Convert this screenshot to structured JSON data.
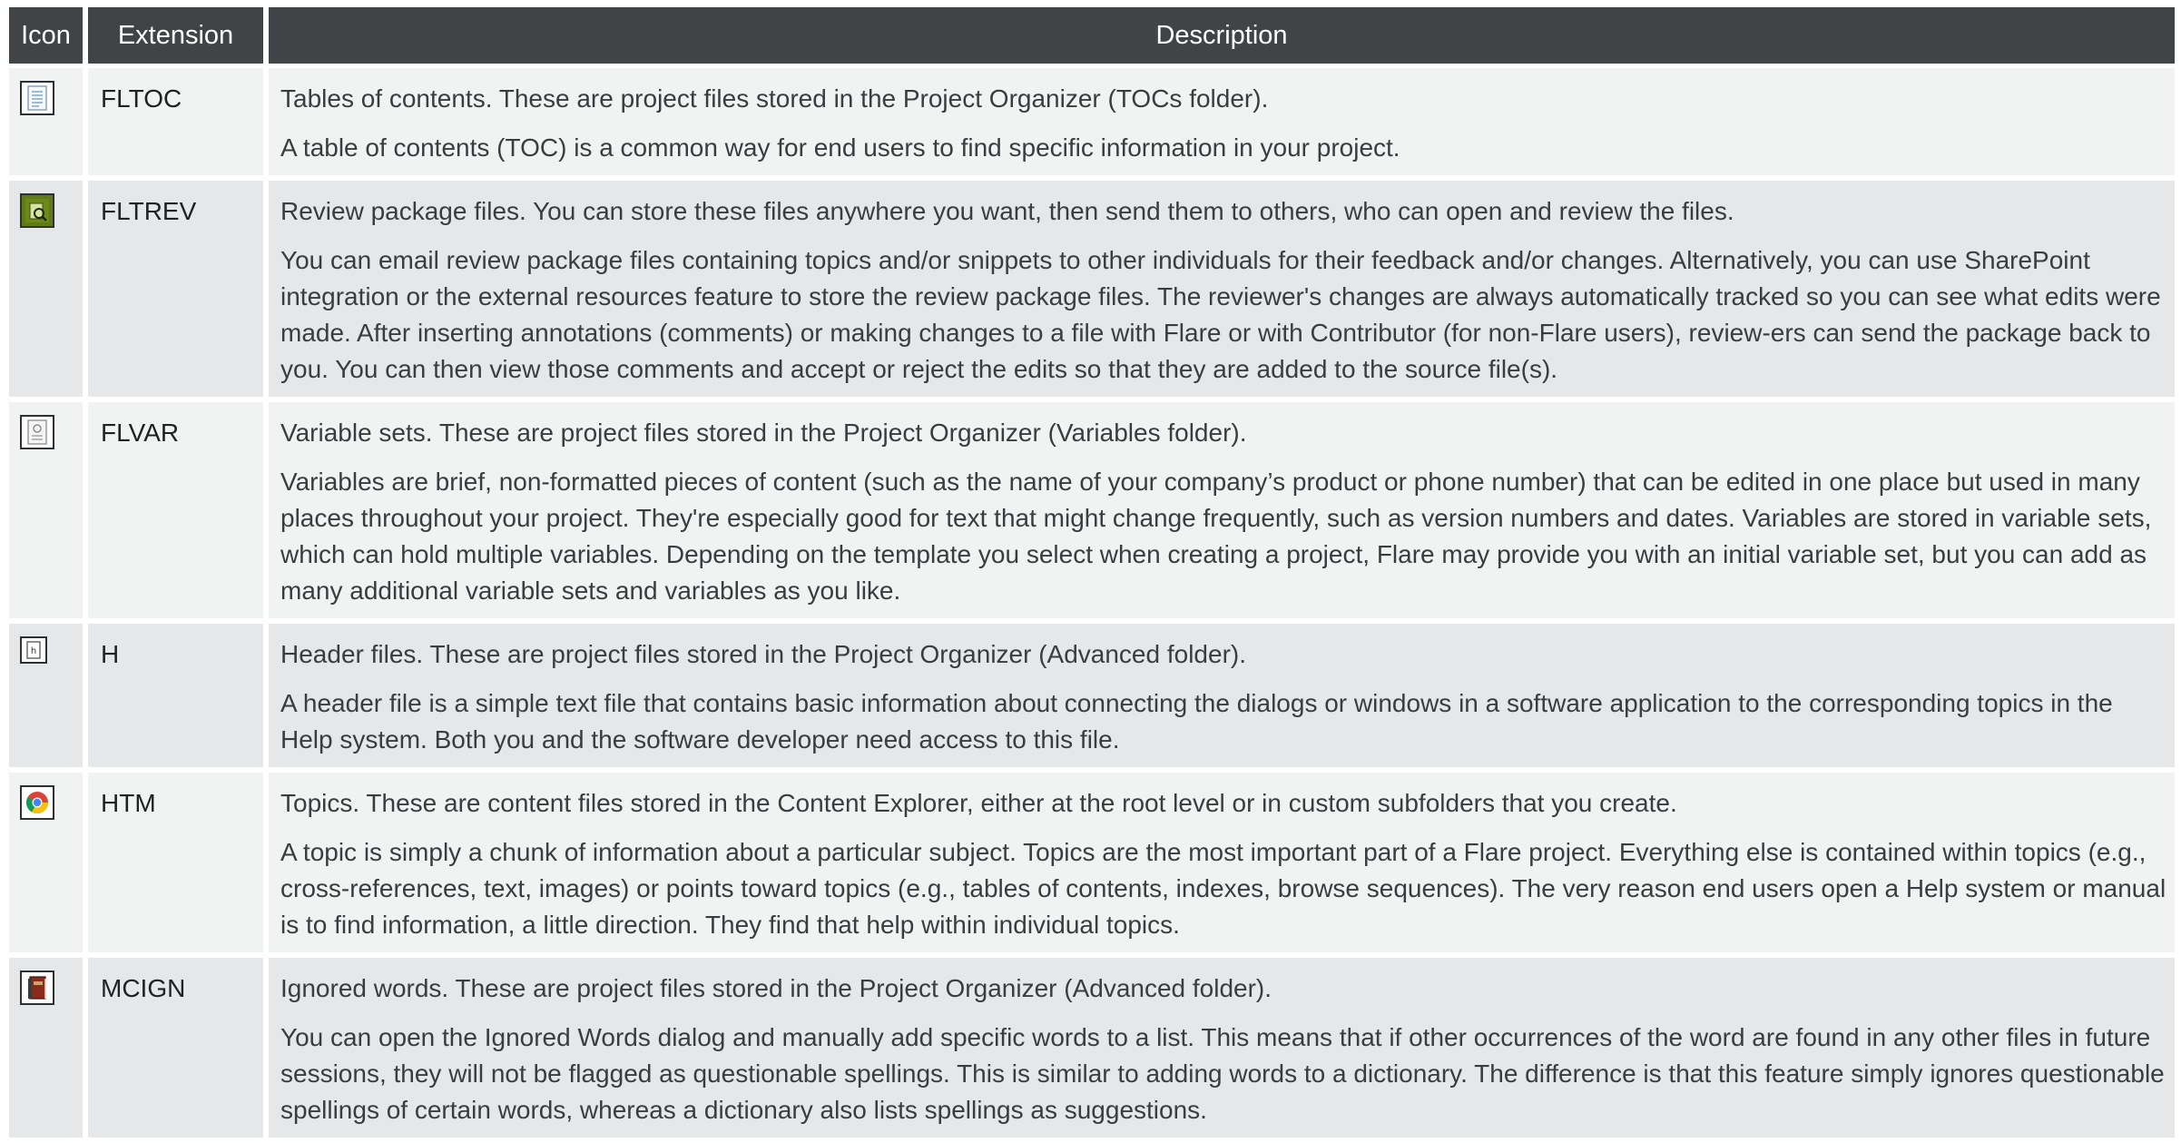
{
  "table": {
    "headers": {
      "icon": "Icon",
      "extension": "Extension",
      "description": "Description"
    },
    "rows": [
      {
        "icon": "toc-document-icon",
        "extension": "FLTOC",
        "summary": "Tables of contents. These are project files stored in the Project Organizer (TOCs folder).",
        "detail": "A table of contents (TOC) is a common way for end users to find specific information in your project."
      },
      {
        "icon": "review-package-icon",
        "extension": "FLTREV",
        "summary": "Review package files. You can store these files anywhere you want, then send them to others, who can open and review the files.",
        "detail": "You can email review package files containing topics and/or snippets to other individuals for their feedback and/or changes. Alternatively, you can use SharePoint integration or the external resources feature to store the review package files. The reviewer's changes are always automatically tracked so you can see what edits were made. After inserting annotations (comments) or making changes to a file with Flare or with Contributor (for non-Flare users), review-ers can send the package back to you. You can then view those comments and accept or reject the edits so that they are added to the source file(s)."
      },
      {
        "icon": "variable-set-icon",
        "extension": "FLVAR",
        "summary": "Variable sets. These are project files stored in the Project Organizer (Variables folder).",
        "detail": "Variables are brief, non-formatted pieces of content (such as the name of your company’s product or phone number) that can be edited in one place but used in many places throughout your project. They're especially good for text that might change frequently, such as version numbers and dates. Variables are stored in variable sets, which can hold multiple variables. Depending on the template you select when creating a project, Flare may provide you with an initial variable set, but you can add as many additional variable sets and variables as you like."
      },
      {
        "icon": "header-file-icon",
        "extension": "H",
        "summary": "Header files. These are project files stored in the Project Organizer (Advanced folder).",
        "detail": "A header file is a simple text file that contains basic information about connecting the dialogs or windows in a software application to the corresponding topics in the Help system. Both you and the software developer need access to this file."
      },
      {
        "icon": "chrome-browser-icon",
        "extension": "HTM",
        "summary": "Topics. These are content files stored in the Content Explorer, either at the root level or in custom subfolders that you create.",
        "detail": "A topic is simply a chunk of information about a particular subject. Topics are the most important part of a Flare project. Everything else is contained within topics (e.g., cross-references, text, images) or points toward topics (e.g., tables of contents, indexes, browse sequences). The very reason end users open a Help system or manual is to find information, a little direction. They find that help within individual topics."
      },
      {
        "icon": "dictionary-book-icon",
        "extension": "MCIGN",
        "summary": "Ignored words. These are project files stored in the Project Organizer (Advanced folder).",
        "detail": "You can open the Ignored Words dialog and manually add specific words to a list. This means that if other occurrences of the word are found in any other files in future sessions, they will not be flagged as questionable spellings. This is similar to adding words to a dictionary. The difference is that this feature simply ignores questionable spellings of certain words, whereas a dictionary also lists spellings as suggestions."
      }
    ]
  }
}
